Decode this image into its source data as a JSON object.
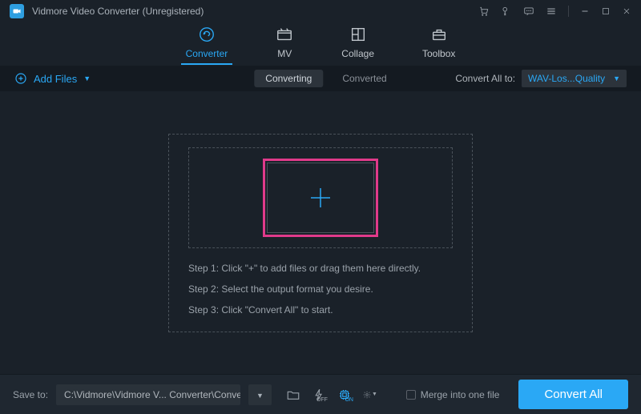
{
  "window": {
    "title": "Vidmore Video Converter (Unregistered)"
  },
  "tabs": {
    "converter": "Converter",
    "mv": "MV",
    "collage": "Collage",
    "toolbox": "Toolbox"
  },
  "toolbar": {
    "add_files": "Add Files",
    "converting": "Converting",
    "converted": "Converted",
    "convert_all_to": "Convert All to:",
    "format": "WAV-Los...Quality"
  },
  "steps": {
    "s1": "Step 1: Click \"+\" to add files or drag them here directly.",
    "s2": "Step 2: Select the output format you desire.",
    "s3": "Step 3: Click \"Convert All\" to start."
  },
  "footer": {
    "save_to": "Save to:",
    "path": "C:\\Vidmore\\Vidmore V... Converter\\Converted",
    "merge": "Merge into one file",
    "convert_all": "Convert All",
    "hw_off": "OFF",
    "hw_on": "ON"
  }
}
